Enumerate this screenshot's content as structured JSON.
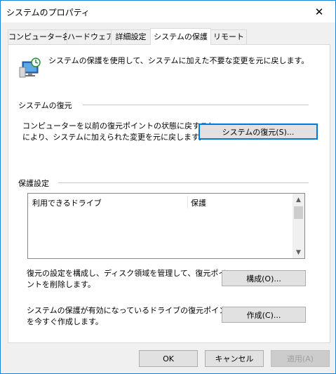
{
  "window": {
    "title": "システムのプロパティ",
    "close_glyph": "✕"
  },
  "tabs": [
    {
      "label": "コンピューター名",
      "active": false
    },
    {
      "label": "ハードウェア",
      "active": false
    },
    {
      "label": "詳細設定",
      "active": false
    },
    {
      "label": "システムの保護",
      "active": true
    },
    {
      "label": "リモート",
      "active": false
    }
  ],
  "intro": {
    "text": "システムの保護を使用して、システムに加えた不要な変更を元に戻します。",
    "icon": "system-protection-icon"
  },
  "restore": {
    "group_label": "システムの復元",
    "line1": "コンピューターを以前の復元ポイントの状態に戻すこと",
    "line2": "により、システムに加えられた変更を元に戻します。",
    "button": "システムの復元(S)..."
  },
  "protection": {
    "group_label": "保護設定",
    "columns": [
      "利用できるドライブ",
      "保護"
    ],
    "rows": []
  },
  "configure": {
    "line1": "復元の設定を構成し、ディスク領域を管理して、復元ポイ",
    "line2": "ントを削除します。",
    "button": "構成(O)..."
  },
  "create": {
    "line1": "システムの保護が有効になっているドライブの復元ポイント",
    "line2": "を今すぐ作成します。",
    "button": "作成(C)..."
  },
  "footer": {
    "ok": "OK",
    "cancel": "キャンセル",
    "apply": "適用(A)"
  },
  "colors": {
    "accent": "#0078d7",
    "window_border": "#1883d7",
    "dialog_bg": "#f0f0f0"
  }
}
